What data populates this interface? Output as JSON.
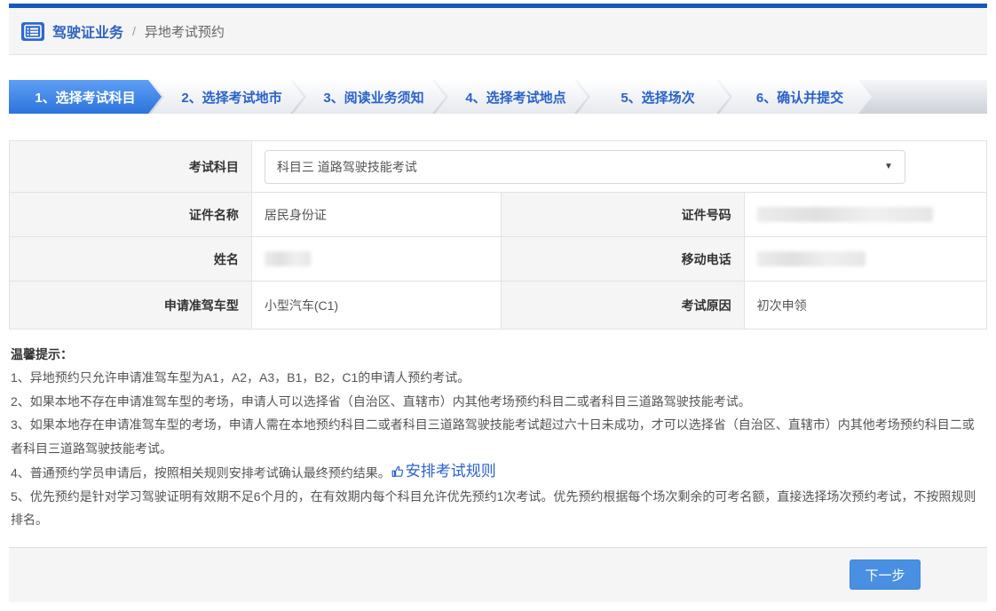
{
  "breadcrumb": {
    "section": "驾驶证业务",
    "separator": "/",
    "current": "异地考试预约"
  },
  "steps": [
    {
      "label": "1、选择考试科目",
      "active": true
    },
    {
      "label": "2、选择考试地市",
      "active": false
    },
    {
      "label": "3、阅读业务须知",
      "active": false
    },
    {
      "label": "4、选择考试地点",
      "active": false
    },
    {
      "label": "5、选择场次",
      "active": false
    },
    {
      "label": "6、确认并提交",
      "active": false
    }
  ],
  "form": {
    "subject_label": "考试科目",
    "subject_value": "科目三 道路驾驶技能考试",
    "id_type_label": "证件名称",
    "id_type_value": "居民身份证",
    "id_number_label": "证件号码",
    "id_number_value": "",
    "name_label": "姓名",
    "name_value": "",
    "phone_label": "移动电话",
    "phone_value": "",
    "vehicle_label": "申请准驾车型",
    "vehicle_value": "小型汽车(C1)",
    "reason_label": "考试原因",
    "reason_value": "初次申领"
  },
  "tips": {
    "title": "温馨提示：",
    "items": [
      "1、异地预约只允许申请准驾车型为A1，A2，A3，B1，B2，C1的申请人预约考试。",
      "2、如果本地不存在申请准驾车型的考场，申请人可以选择省（自治区、直辖市）内其他考场预约科目二或者科目三道路驾驶技能考试。",
      "3、如果本地存在申请准驾车型的考场，申请人需在本地预约科目二或者科目三道路驾驶技能考试超过六十日未成功，才可以选择省（自治区、直辖市）内其他考场预约科目二或者科目三道路驾驶技能考试。",
      "4、普通预约学员申请后，按照相关规则安排考试确认最终预约结果。",
      "5、优先预约是针对学习驾驶证明有效期不足6个月的，在有效期内每个科目允许优先预约1次考试。优先预约根据每个场次剩余的可考名额，直接选择场次预约考试，不按照规则排名。"
    ],
    "rules_link": "安排考试规则"
  },
  "footer": {
    "next_button": "下一步"
  },
  "icons": {
    "breadcrumb_icon": "list-icon",
    "rules_link_icon": "thumbs-up-icon",
    "select_arrow": "▼"
  },
  "colors": {
    "accent_bar": "#1558bb",
    "active_step": "#2c73dc",
    "link_blue": "#2a62c9",
    "next_button": "#4a90e2",
    "label_bg": "#f5f5f5"
  }
}
